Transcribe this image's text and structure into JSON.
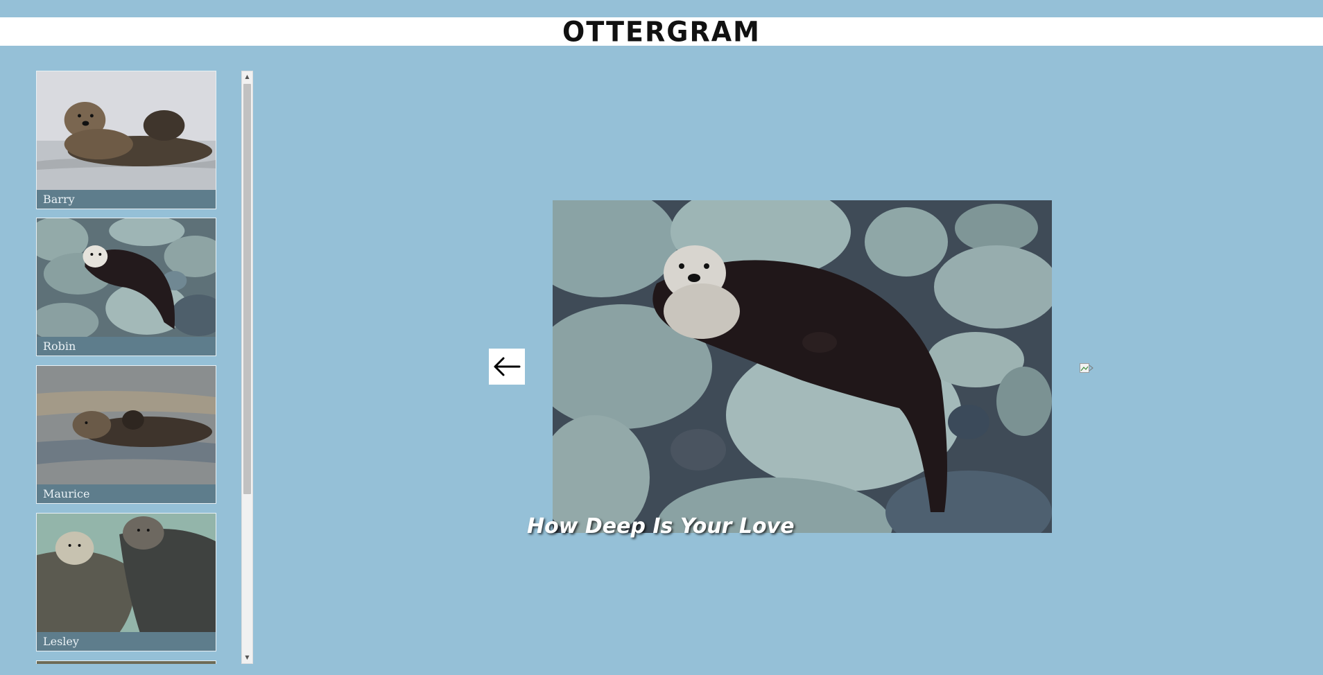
{
  "header": {
    "title": "OTTERGRAM"
  },
  "thumbnails": [
    {
      "name": "Barry"
    },
    {
      "name": "Robin"
    },
    {
      "name": "Maurice"
    },
    {
      "name": "Lesley"
    }
  ],
  "detail": {
    "title": "How Deep Is Your Love"
  },
  "nav": {
    "prev_icon": "arrow-left-icon",
    "next_icon": "broken-image-icon"
  },
  "colors": {
    "background": "#95c0d7",
    "caption_bg": "#5e7d8c",
    "header_bg": "#ffffff"
  }
}
